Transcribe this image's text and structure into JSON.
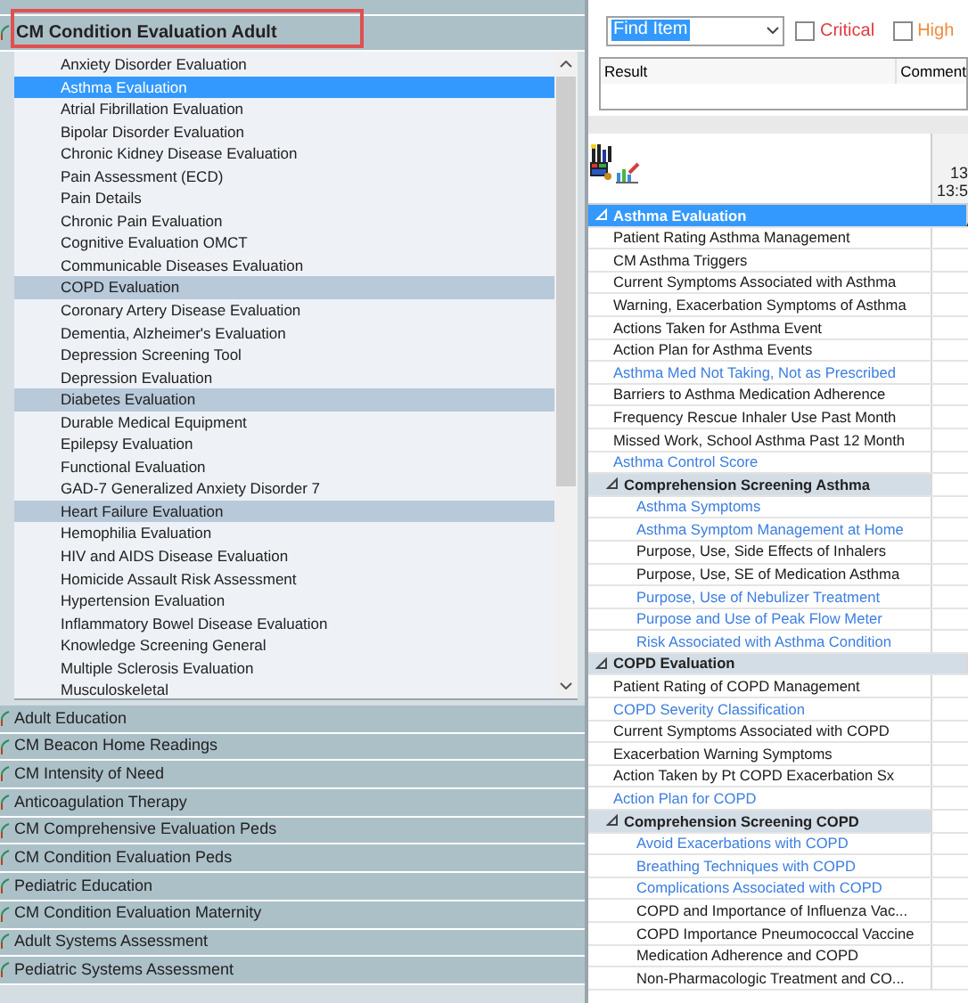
{
  "band": {
    "title": "CM Condition Evaluation Adult",
    "highlighted": true
  },
  "items": [
    {
      "label": "Anxiety Disorder Evaluation",
      "selected": false,
      "highlighted": false
    },
    {
      "label": "Asthma Evaluation",
      "selected": true,
      "highlighted": false
    },
    {
      "label": "Atrial Fibrillation Evaluation",
      "selected": false,
      "highlighted": false
    },
    {
      "label": "Bipolar Disorder Evaluation",
      "selected": false,
      "highlighted": false
    },
    {
      "label": "Chronic Kidney Disease Evaluation",
      "selected": false,
      "highlighted": false
    },
    {
      "label": "Pain Assessment (ECD)",
      "selected": false,
      "highlighted": false
    },
    {
      "label": "Pain Details",
      "selected": false,
      "highlighted": false
    },
    {
      "label": "Chronic Pain Evaluation",
      "selected": false,
      "highlighted": false
    },
    {
      "label": "Cognitive Evaluation OMCT",
      "selected": false,
      "highlighted": false
    },
    {
      "label": "Communicable Diseases Evaluation",
      "selected": false,
      "highlighted": false
    },
    {
      "label": "COPD Evaluation",
      "selected": false,
      "highlighted": true
    },
    {
      "label": "Coronary Artery Disease Evaluation",
      "selected": false,
      "highlighted": false
    },
    {
      "label": "Dementia, Alzheimer's Evaluation",
      "selected": false,
      "highlighted": false
    },
    {
      "label": "Depression Screening Tool",
      "selected": false,
      "highlighted": false
    },
    {
      "label": "Depression Evaluation",
      "selected": false,
      "highlighted": false
    },
    {
      "label": "Diabetes Evaluation",
      "selected": false,
      "highlighted": true
    },
    {
      "label": "Durable Medical Equipment",
      "selected": false,
      "highlighted": false
    },
    {
      "label": "Epilepsy Evaluation",
      "selected": false,
      "highlighted": false
    },
    {
      "label": "Functional Evaluation",
      "selected": false,
      "highlighted": false
    },
    {
      "label": "GAD-7 Generalized Anxiety Disorder 7",
      "selected": false,
      "highlighted": false
    },
    {
      "label": "Heart Failure Evaluation",
      "selected": false,
      "highlighted": true
    },
    {
      "label": "Hemophilia Evaluation",
      "selected": false,
      "highlighted": false
    },
    {
      "label": "HIV and AIDS Disease Evaluation",
      "selected": false,
      "highlighted": false
    },
    {
      "label": "Homicide Assault Risk Assessment",
      "selected": false,
      "highlighted": false
    },
    {
      "label": "Hypertension Evaluation",
      "selected": false,
      "highlighted": false
    },
    {
      "label": "Inflammatory Bowel Disease Evaluation",
      "selected": false,
      "highlighted": false
    },
    {
      "label": "Knowledge Screening General",
      "selected": false,
      "highlighted": false
    },
    {
      "label": "Multiple Sclerosis Evaluation",
      "selected": false,
      "highlighted": false
    },
    {
      "label": "Musculoskeletal",
      "selected": false,
      "highlighted": false
    }
  ],
  "bands": [
    "Adult Education",
    "CM Beacon Home Readings",
    "CM Intensity of Need",
    "Anticoagulation Therapy",
    "CM Comprehensive Evaluation Peds",
    "CM Condition Evaluation Peds",
    "Pediatric Education",
    "CM Condition Evaluation Maternity",
    "Adult Systems Assessment",
    "Pediatric Systems Assessment"
  ],
  "find": {
    "value": "Find Item"
  },
  "filters": [
    {
      "label": "Critical",
      "checked": false,
      "color": "#e0393e"
    },
    {
      "label": "High",
      "checked": false,
      "color": "#f08a3c"
    }
  ],
  "result_columns": [
    "Result",
    "Comment"
  ],
  "grid_column": [
    "13",
    "13:5"
  ],
  "sections": [
    {
      "label": "Asthma Evaluation",
      "selected": true,
      "expanded": true,
      "children": [
        {
          "label": "Patient Rating Asthma Management",
          "color": "#1a1a1a"
        },
        {
          "label": "CM Asthma Triggers",
          "color": "#1a1a1a"
        },
        {
          "label": "Current Symptoms Associated with Asthma",
          "color": "#1a1a1a"
        },
        {
          "label": "Warning, Exacerbation Symptoms of Asthma",
          "color": "#1a1a1a"
        },
        {
          "label": "Actions Taken for Asthma Event",
          "color": "#1a1a1a"
        },
        {
          "label": "Action Plan for Asthma Events",
          "color": "#1a1a1a"
        },
        {
          "label": "Asthma Med Not Taking, Not as Prescribed",
          "color": "#3c7ee0"
        },
        {
          "label": "Barriers to Asthma Medication Adherence",
          "color": "#1a1a1a"
        },
        {
          "label": "Frequency Rescue Inhaler Use Past Month",
          "color": "#1a1a1a"
        },
        {
          "label": "Missed Work, School Asthma Past 12 Month",
          "color": "#1a1a1a"
        },
        {
          "label": "Asthma Control Score",
          "color": "#3c7ee0"
        },
        {
          "label": "Comprehension Screening Asthma",
          "expanded": true,
          "children": [
            {
              "label": "Asthma Symptoms",
              "color": "#3c7ee0"
            },
            {
              "label": "Asthma Symptom Management at Home",
              "color": "#3c7ee0"
            },
            {
              "label": "Purpose, Use, Side Effects of Inhalers",
              "color": "#1a1a1a"
            },
            {
              "label": "Purpose, Use, SE of Medication Asthma",
              "color": "#1a1a1a"
            },
            {
              "label": "Purpose, Use of Nebulizer Treatment",
              "color": "#3c7ee0"
            },
            {
              "label": "Purpose and Use of Peak Flow Meter",
              "color": "#3c7ee0"
            },
            {
              "label": "Risk Associated with Asthma Condition",
              "color": "#3c7ee0"
            }
          ]
        }
      ]
    },
    {
      "label": "COPD Evaluation",
      "selected": false,
      "expanded": true,
      "children": [
        {
          "label": "Patient Rating of COPD Management",
          "color": "#1a1a1a"
        },
        {
          "label": "COPD Severity Classification",
          "color": "#3c7ee0"
        },
        {
          "label": "Current Symptoms Associated with COPD",
          "color": "#1a1a1a"
        },
        {
          "label": "Exacerbation Warning Symptoms",
          "color": "#1a1a1a"
        },
        {
          "label": "Action Taken by Pt COPD Exacerbation Sx",
          "color": "#1a1a1a"
        },
        {
          "label": "Action Plan for COPD",
          "color": "#3c7ee0"
        },
        {
          "label": "Comprehension Screening COPD",
          "expanded": true,
          "children": [
            {
              "label": "Avoid Exacerbations with COPD",
              "color": "#3c7ee0"
            },
            {
              "label": "Breathing Techniques with COPD",
              "color": "#3c7ee0"
            },
            {
              "label": "Complications Associated with COPD",
              "color": "#3c7ee0"
            },
            {
              "label": "COPD and Importance of Influenza Vac...",
              "color": "#1a1a1a"
            },
            {
              "label": "COPD Importance Pneumococcal Vaccine",
              "color": "#1a1a1a"
            },
            {
              "label": "Medication Adherence and COPD",
              "color": "#1a1a1a"
            },
            {
              "label": "Non-Pharmacologic Treatment and CO...",
              "color": "#1a1a1a"
            }
          ]
        }
      ]
    }
  ]
}
